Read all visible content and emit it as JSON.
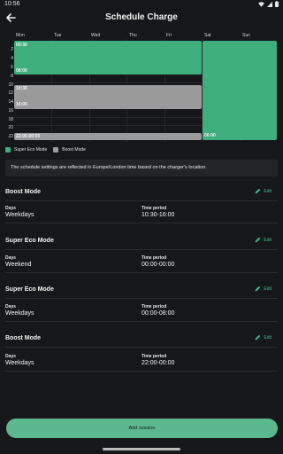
{
  "status_bar": {
    "time": "10:56"
  },
  "header": {
    "title": "Schedule Charge"
  },
  "calendar": {
    "days": [
      "Mon",
      "Tue",
      "Wed",
      "Thu",
      "Fri",
      "Sat",
      "Sun"
    ],
    "hours": [
      "2",
      "4",
      "6",
      "8",
      "10",
      "12",
      "14",
      "16",
      "18",
      "20",
      "22"
    ],
    "blocks": [
      {
        "label_start": "00:30",
        "label_end": "08:00",
        "mode": "super_eco"
      },
      {
        "label_start": "10:30",
        "label_end": "16:00",
        "mode": "boost"
      },
      {
        "label_start": "22:00-00:00",
        "label_end": "",
        "mode": "boost"
      },
      {
        "label_start": "",
        "label_end": "00:00",
        "mode": "super_eco"
      }
    ]
  },
  "legend": {
    "super_eco": "Super Eco Mode",
    "boost": "Boost Mode"
  },
  "colors": {
    "super_eco": "#3dae7c",
    "boost": "#9a9a9a",
    "accent": "#3fbf8a",
    "background": "#16171a"
  },
  "info_banner": "The schedule settings are reflected in Europe/London time based on the charger's location.",
  "sessions": [
    {
      "mode": "Boost Mode",
      "edit": "Edit",
      "days_label": "Days",
      "days": "Weekdays",
      "period_label": "Time period",
      "period": "10:30-16:00"
    },
    {
      "mode": "Super Eco Mode",
      "edit": "Edit",
      "days_label": "Days",
      "days": "Weekend",
      "period_label": "Time period",
      "period": "00:00-00:00"
    },
    {
      "mode": "Super Eco Mode",
      "edit": "Edit",
      "days_label": "Days",
      "days": "Weekdays",
      "period_label": "Time period",
      "period": "00:00-08:00"
    },
    {
      "mode": "Boost Mode",
      "edit": "Edit",
      "days_label": "Days",
      "days": "Weekdays",
      "period_label": "Time period",
      "period": "22:00-00:00"
    }
  ],
  "add_session": "Add session"
}
